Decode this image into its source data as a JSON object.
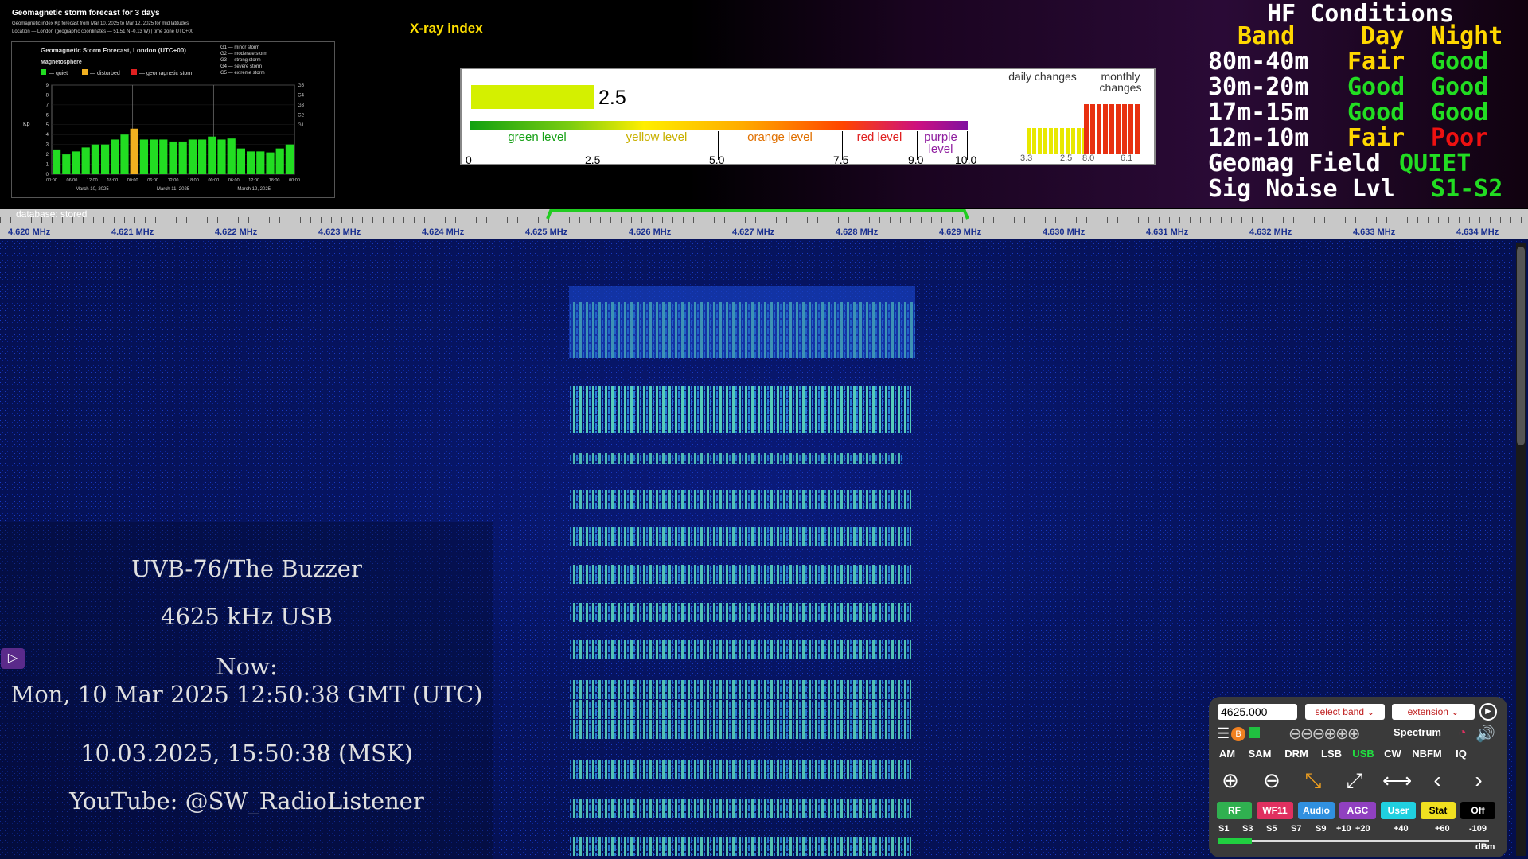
{
  "storm_forecast": {
    "title": "Geomagnetic storm forecast for 3 days",
    "subtitle": "Geomagnetic index Kp forecast from Mar 10, 2025 to Mar 12, 2025 for mid latitudes",
    "location": "Location — London (geographic coordinates — 51.51 N -0.13 W) | time zone UTC+00",
    "chart_title": "Geomagnetic Storm Forecast, London (UTC+00)",
    "section": "Magnetosphere",
    "legend": [
      "— quiet",
      "— disturbed",
      "— geomagnetic storm"
    ],
    "g_scale": [
      "G1 — minor storm",
      "G2 — moderate storm",
      "G3 — strong storm",
      "G4 — severe storm",
      "G5 — extreme storm"
    ],
    "y_label": "Kp",
    "y_ticks": [
      "9",
      "8",
      "7",
      "6",
      "5",
      "4",
      "3",
      "2",
      "1",
      "0"
    ],
    "g_ticks": [
      "G5",
      "G4",
      "G3",
      "G2",
      "G1"
    ],
    "x_ticks": [
      "00:00",
      "06:00",
      "12:00",
      "18:00",
      "00:00",
      "06:00",
      "12:00",
      "18:00",
      "00:00",
      "06:00",
      "12:00",
      "18:00",
      "00:00"
    ],
    "dates": [
      "March 10, 2025",
      "March 11, 2025",
      "March 12, 2025"
    ],
    "kp_values": [
      2.5,
      2.0,
      2.3,
      2.7,
      3.0,
      3.0,
      3.5,
      4.0,
      4.6,
      3.5,
      3.5,
      3.5,
      3.3,
      3.3,
      3.5,
      3.5,
      3.8,
      3.5,
      3.6,
      2.6,
      2.3,
      2.3,
      2.2,
      2.6,
      3.0
    ],
    "kp_colors": [
      "green",
      "green",
      "green",
      "green",
      "green",
      "green",
      "green",
      "green",
      "orange",
      "green",
      "green",
      "green",
      "green",
      "green",
      "green",
      "green",
      "green",
      "green",
      "green",
      "green",
      "green",
      "green",
      "green",
      "green",
      "green"
    ],
    "colors": {
      "quiet": "#22dd22",
      "disturbed": "#f0b020",
      "storm": "#e02020"
    }
  },
  "xray": {
    "label": "X-ray index",
    "value": "2.5",
    "levels": [
      "green level",
      "yellow level",
      "orange level",
      "red level",
      "purple level"
    ],
    "ticks": [
      "0",
      "2.5",
      "5.0",
      "7.5",
      "9.0",
      "10.0"
    ],
    "daily_label": "daily changes",
    "daily_ticks": [
      "3.3",
      "2.5"
    ],
    "monthly_label": "monthly changes",
    "monthly_ticks": [
      "8.0",
      "6.1"
    ]
  },
  "hf": {
    "title": "HF Conditions",
    "header": {
      "band": "Band",
      "day": "Day",
      "night": "Night"
    },
    "rows": [
      {
        "band": "80m-40m",
        "day": "Fair",
        "night": "Good"
      },
      {
        "band": "30m-20m",
        "day": "Good",
        "night": "Good"
      },
      {
        "band": "17m-15m",
        "day": "Good",
        "night": "Good"
      },
      {
        "band": "12m-10m",
        "day": "Fair",
        "night": "Poor"
      }
    ],
    "geomag_label": "Geomag Field",
    "geomag_value": "QUIET",
    "noise_label": "Sig Noise Lvl",
    "noise_value": "S1-S2"
  },
  "scale": {
    "db_label": "database: stored",
    "freqs": [
      "4.620 MHz",
      "4.621 MHz",
      "4.622 MHz",
      "4.623 MHz",
      "4.624 MHz",
      "4.625 MHz",
      "4.626 MHz",
      "4.627 MHz",
      "4.628 MHz",
      "4.629 MHz",
      "4.630 MHz",
      "4.631 MHz",
      "4.632 MHz",
      "4.633 MHz",
      "4.634 MHz"
    ]
  },
  "overlay": {
    "station": "UVB-76/The Buzzer",
    "freq": "4625 kHz USB",
    "now_label": "Now:",
    "utc": "Mon, 10 Mar 2025 12:50:38 GMT (UTC)",
    "msk": "10.03.2025, 15:50:38 (MSK)",
    "youtube": "YouTube: @SW_RadioListener"
  },
  "panel": {
    "freq_value": "4625.000",
    "band_select": "select band",
    "extension_select": "extension",
    "spectrum": "Spectrum",
    "modes": [
      "AM",
      "SAM",
      "DRM",
      "LSB",
      "USB",
      "CW",
      "NBFM",
      "IQ"
    ],
    "active_mode": "USB",
    "buttons": [
      "RF",
      "WF11",
      "Audio",
      "AGC",
      "User",
      "Stat",
      "Off"
    ],
    "smeter_labels": [
      "S1",
      "S3",
      "S5",
      "S7",
      "S9",
      "+10",
      "+20",
      "+40",
      "+60",
      "-109"
    ],
    "dbm": "dBm"
  }
}
